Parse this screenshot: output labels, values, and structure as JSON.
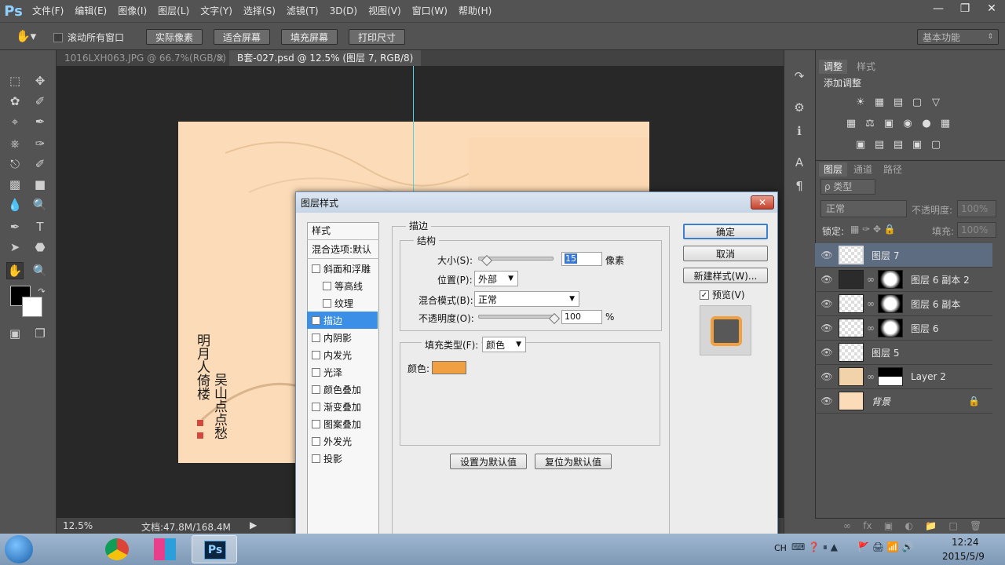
{
  "app": {
    "logo": "Ps"
  },
  "menu": [
    "文件(F)",
    "编辑(E)",
    "图像(I)",
    "图层(L)",
    "文字(Y)",
    "选择(S)",
    "滤镜(T)",
    "3D(D)",
    "视图(V)",
    "窗口(W)",
    "帮助(H)"
  ],
  "options": {
    "scroll_all": "滚动所有窗口",
    "actual_pixels": "实际像素",
    "fit_screen": "适合屏幕",
    "fill_screen": "填充屏幕",
    "print_size": "打印尺寸",
    "workspace": "基本功能"
  },
  "tabs": [
    {
      "label": "1016LXH063.JPG @ 66.7%(RGB/8)",
      "close": "×"
    },
    {
      "label": "B套-027.psd @ 12.5% (图层 7, RGB/8) *",
      "close": "×"
    }
  ],
  "document": {
    "bg_color": "#fcdcb8",
    "signature_left": "明月人倚楼",
    "signature_right": "吴山点点愁"
  },
  "status": {
    "zoom": "12.5%",
    "doc_size": "文档:47.8M/168.4M"
  },
  "adjustments_panel": {
    "tabs": [
      "调整",
      "样式"
    ],
    "heading": "添加调整"
  },
  "layers_panel": {
    "tabs": [
      "图层",
      "通道",
      "路径"
    ],
    "filter_label": "ρ 类型",
    "blend_mode": "正常",
    "opacity_label": "不透明度:",
    "opacity_value": "100%",
    "lock_label": "锁定:",
    "fill_label": "填充:",
    "fill_value": "100%",
    "layers": [
      {
        "name": "图层 7",
        "selected": true
      },
      {
        "name": "图层 6 副本 2",
        "selected": false
      },
      {
        "name": "图层 6 副本",
        "selected": false
      },
      {
        "name": "图层 6",
        "selected": false
      },
      {
        "name": "图层 5",
        "selected": false
      },
      {
        "name": "Layer 2",
        "selected": false
      },
      {
        "name": "背景",
        "selected": false
      }
    ]
  },
  "dialog": {
    "title": "图层样式",
    "close": "✕",
    "styles_header": "样式",
    "blend_options": "混合选项:默认",
    "styles": [
      {
        "label": "斜面和浮雕",
        "checked": false,
        "indent": false
      },
      {
        "label": "等高线",
        "checked": false,
        "indent": true
      },
      {
        "label": "纹理",
        "checked": false,
        "indent": true
      },
      {
        "label": "描边",
        "checked": true,
        "indent": false
      },
      {
        "label": "内阴影",
        "checked": false,
        "indent": false
      },
      {
        "label": "内发光",
        "checked": false,
        "indent": false
      },
      {
        "label": "光泽",
        "checked": false,
        "indent": false
      },
      {
        "label": "颜色叠加",
        "checked": false,
        "indent": false
      },
      {
        "label": "渐变叠加",
        "checked": false,
        "indent": false
      },
      {
        "label": "图案叠加",
        "checked": false,
        "indent": false
      },
      {
        "label": "外发光",
        "checked": false,
        "indent": false
      },
      {
        "label": "投影",
        "checked": false,
        "indent": false
      }
    ],
    "section_title": "描边",
    "structure_title": "结构",
    "size_label": "大小(S):",
    "size_value": "15",
    "size_unit": "像素",
    "position_label": "位置(P):",
    "position_value": "外部",
    "blend_mode_label": "混合模式(B):",
    "blend_mode_value": "正常",
    "opacity_label": "不透明度(O):",
    "opacity_value": "100",
    "opacity_unit": "%",
    "size_fraction": 0.06,
    "opacity_fraction": 1.0,
    "fill_type_label": "填充类型(F):",
    "fill_type_value": "颜色",
    "color_label": "颜色:",
    "stroke_color": "#f0a040",
    "set_default": "设置为默认值",
    "reset_default": "复位为默认值",
    "ok": "确定",
    "cancel": "取消",
    "new_style": "新建样式(W)...",
    "preview_label": "预览(V)",
    "preview_checked": "✓"
  },
  "taskbar": {
    "ime": "CH",
    "time": "12:24",
    "date": "2015/5/9"
  }
}
